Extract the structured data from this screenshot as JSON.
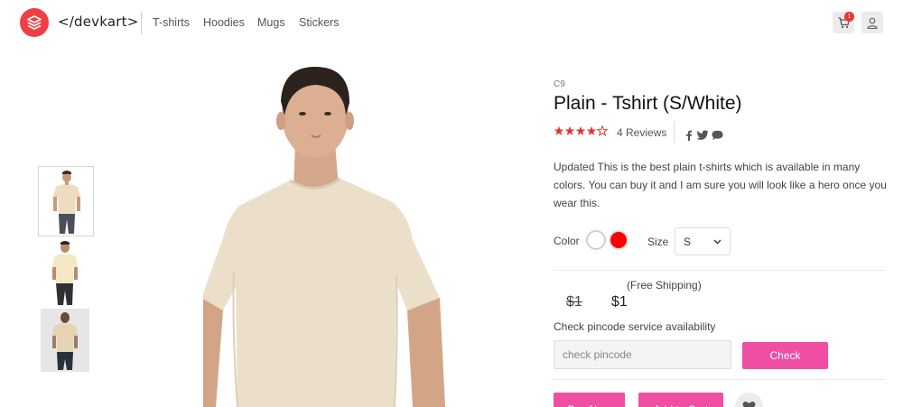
{
  "header": {
    "brand": "</devkart>",
    "nav": [
      "T-shirts",
      "Hoodies",
      "Mugs",
      "Stickers"
    ],
    "cart_count": "1",
    "icons": [
      "layers-logo-icon",
      "cart-icon",
      "user-icon"
    ]
  },
  "thumbnails": [
    {
      "name": "front-view"
    },
    {
      "name": "side-view"
    },
    {
      "name": "back-view"
    }
  ],
  "product": {
    "sku": "C9",
    "title": "Plain - Tshirt (S/White)",
    "rating": 4,
    "rating_max": 5,
    "reviews": "4 Reviews",
    "social": [
      "facebook-icon",
      "twitter-icon",
      "chat-icon"
    ],
    "description": "Updated This is the best plain t-shirts which is available in many colors. You can buy it and I am sure you will look like a hero once you wear this.",
    "color_label": "Color",
    "colors": [
      "#ffffff",
      "#ff0000"
    ],
    "size_label": "Size",
    "size_value": "S",
    "shipping_note": "(Free Shipping)",
    "old_price": "$1",
    "price": "$1",
    "pincode_label": "Check pincode service availability",
    "pincode_placeholder": "check pincode",
    "check_button": "Check",
    "buy_button": "Buy Now",
    "cart_button": "Add to Cart"
  },
  "colors": {
    "accent": "#ef4ea3",
    "brand": "#ef3f45",
    "star": "#e5342f"
  }
}
